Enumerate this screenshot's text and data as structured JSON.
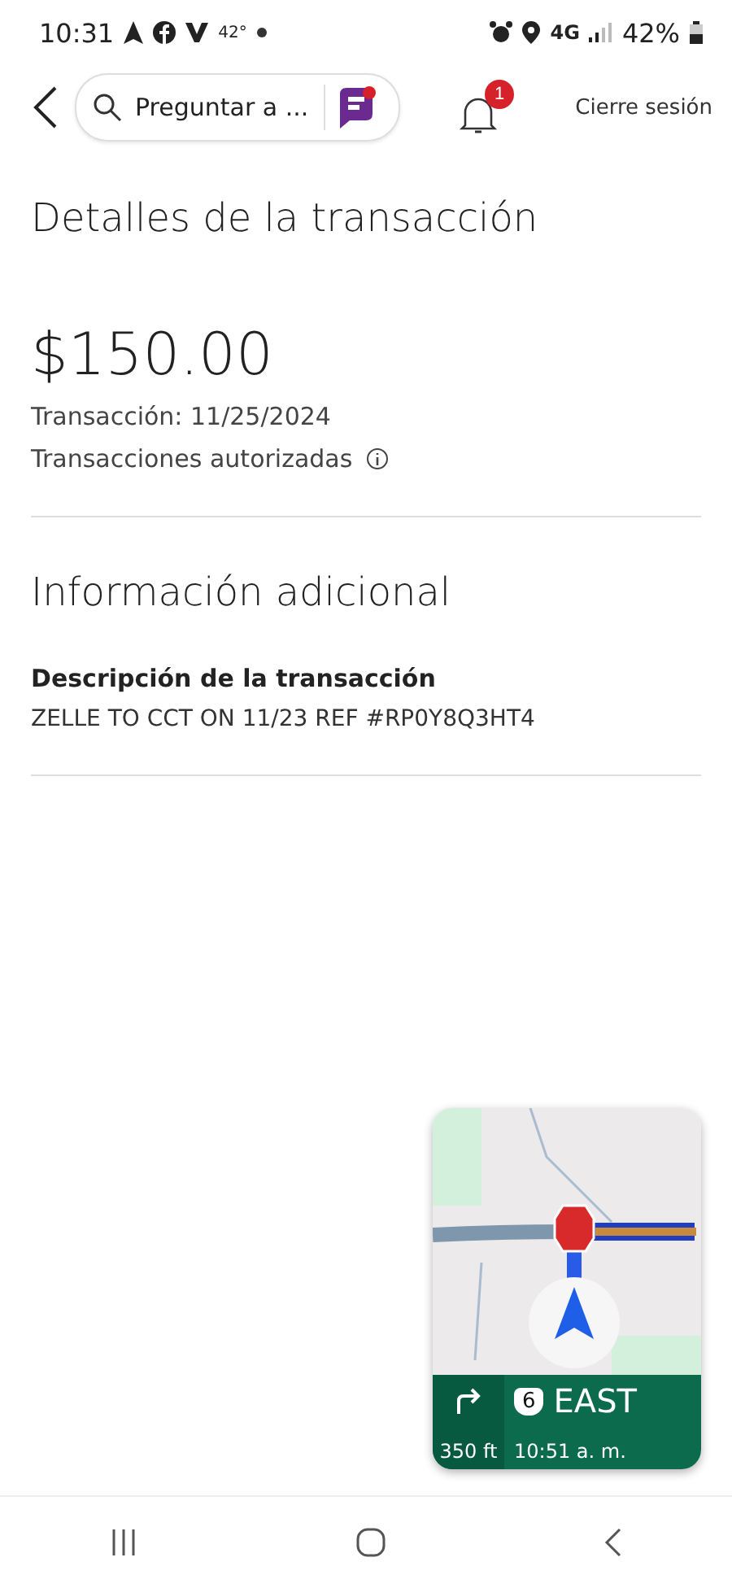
{
  "status_bar": {
    "time": "10:31",
    "temperature": "42°",
    "network": "4G",
    "battery": "42%"
  },
  "header": {
    "search": {
      "placeholder": "Preguntar a ..."
    },
    "notifications": {
      "count": "1"
    },
    "logout": "Cierre sesión"
  },
  "title": "Detalles de la transacción",
  "amount": "$150.00",
  "date": "Transacción: 11/25/2024",
  "status": "Transacciones autorizadas",
  "section_title": "Información adicional",
  "description": {
    "label": "Descripción de la transacción",
    "value": "ZELLE TO CCT ON 11/23 REF #RP0Y8Q3HT4"
  },
  "navigation_overlay": {
    "route_shield": "6",
    "direction": "EAST",
    "distance": "350 ft",
    "arrival": "10:51 a. m."
  }
}
